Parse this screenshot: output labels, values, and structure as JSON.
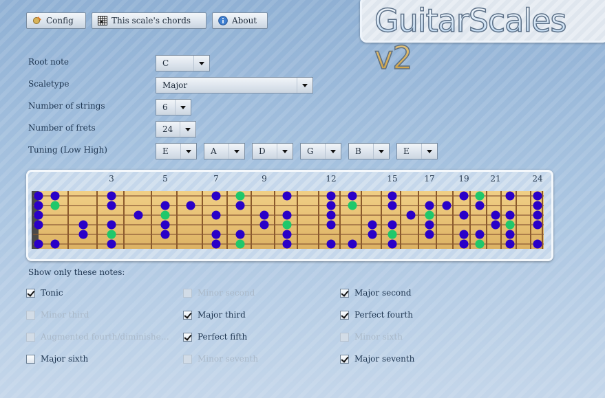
{
  "toolbar": {
    "config_label": "Config",
    "chords_label": "This scale's chords",
    "about_label": "About"
  },
  "logo": {
    "text": "GuitarScales v2"
  },
  "settings": {
    "root_note": {
      "label": "Root note",
      "value": "C"
    },
    "scaletype": {
      "label": "Scaletype",
      "value": "Major"
    },
    "strings": {
      "label": "Number of strings",
      "value": "6"
    },
    "frets": {
      "label": "Number of frets",
      "value": "24"
    },
    "tuning": {
      "label": "Tuning (Low  High)",
      "values": [
        "E",
        "A",
        "D",
        "G",
        "B",
        "E"
      ]
    }
  },
  "fretboard": {
    "fret_markers": [
      "3",
      "5",
      "7",
      "9",
      "12",
      "15",
      "17",
      "19",
      "21",
      "24"
    ],
    "marker_frets": [
      3,
      5,
      7,
      9,
      12,
      15,
      17,
      19,
      21,
      24
    ],
    "num_frets": 24,
    "colors": {
      "note": "#2a00c8",
      "tonic": "#1fc86a",
      "wood": "#e8c175",
      "wire": "#8b5a2b",
      "string": "#8a5a35"
    },
    "strings_high_to_low": [
      {
        "notes": [
          0,
          1,
          3,
          7,
          10,
          12,
          13,
          15,
          19,
          22,
          24
        ],
        "tonic": [
          8,
          20
        ]
      },
      {
        "notes": [
          0,
          3,
          5,
          6,
          8,
          12,
          15,
          17,
          18,
          20,
          24
        ],
        "tonic": [
          1,
          13
        ]
      },
      {
        "notes": [
          0,
          4,
          7,
          9,
          10,
          12,
          16,
          19,
          21,
          22,
          24
        ],
        "tonic": [
          5,
          17
        ]
      },
      {
        "notes": [
          0,
          2,
          3,
          5,
          9,
          12,
          14,
          15,
          17,
          21,
          24
        ],
        "tonic": [
          10,
          22
        ]
      },
      {
        "notes": [
          2,
          5,
          7,
          8,
          10,
          14,
          17,
          19,
          20,
          22
        ],
        "tonic": [
          3,
          15
        ]
      },
      {
        "notes": [
          0,
          1,
          3,
          7,
          10,
          12,
          13,
          15,
          19,
          22,
          24
        ],
        "tonic": [
          8,
          20
        ]
      }
    ]
  },
  "filter": {
    "title": "Show only these notes:",
    "items": [
      {
        "label": "Tonic",
        "checked": true,
        "enabled": true
      },
      {
        "label": "Minor second",
        "checked": false,
        "enabled": false
      },
      {
        "label": "Major second",
        "checked": true,
        "enabled": true
      },
      {
        "label": "Minor third",
        "checked": false,
        "enabled": false
      },
      {
        "label": "Major third",
        "checked": true,
        "enabled": true
      },
      {
        "label": "Perfect fourth",
        "checked": true,
        "enabled": true
      },
      {
        "label": "Augmented fourth/diminishe…",
        "checked": false,
        "enabled": false
      },
      {
        "label": "Perfect fifth",
        "checked": true,
        "enabled": true
      },
      {
        "label": "Minor sixth",
        "checked": false,
        "enabled": false
      },
      {
        "label": "Major sixth",
        "checked": false,
        "enabled": true
      },
      {
        "label": "Minor seventh",
        "checked": false,
        "enabled": false
      },
      {
        "label": "Major seventh",
        "checked": true,
        "enabled": true
      }
    ]
  }
}
